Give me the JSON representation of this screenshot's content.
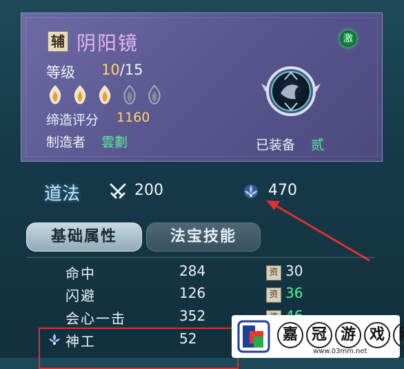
{
  "item": {
    "tag": "辅",
    "name": "阴阳镜",
    "awaken_icon": "激",
    "level_label": "等级",
    "level_current": "10",
    "level_max": "/15",
    "flames": [
      {
        "state": "lit"
      },
      {
        "state": "lit"
      },
      {
        "state": "lit"
      },
      {
        "state": "unlit"
      },
      {
        "state": "unlit"
      }
    ],
    "score_label": "缔造评分",
    "score_value": "1160",
    "maker_label": "制造者",
    "maker_value": "雲劃",
    "equipped_label": "已装备",
    "equipped_value": "贰"
  },
  "daofa": {
    "label": "道法",
    "attack_icon": "crossed-swords-icon",
    "attack_value": "200",
    "defense_icon": "lotus-shield-icon",
    "defense_value": "470"
  },
  "tabs": [
    {
      "label": "基础属性",
      "active": true
    },
    {
      "label": "法宝技能",
      "active": false
    }
  ],
  "attributes": [
    {
      "name": "命中",
      "value": "284",
      "zi": "资",
      "zi_value": "30",
      "zi_color": "#eef2f5"
    },
    {
      "name": "闪避",
      "value": "126",
      "zi": "资",
      "zi_value": "36",
      "zi_color": "#57ef9a"
    },
    {
      "name": "会心一击",
      "value": "352",
      "zi": "资",
      "zi_value": "46",
      "zi_color": "#57ef9a"
    },
    {
      "name": "神工",
      "value": "52",
      "zi": "",
      "zi_value": "",
      "zi_color": "#eef2f5"
    }
  ],
  "watermark": {
    "chars": [
      "嘉",
      "冠",
      "游",
      "戏",
      "网"
    ],
    "url": "www.03mm.net"
  },
  "colors": {
    "gold": "#ffd66b",
    "green": "#57ef9a",
    "title_purple": "#e3b6f2",
    "highlight_red": "#e03030"
  }
}
